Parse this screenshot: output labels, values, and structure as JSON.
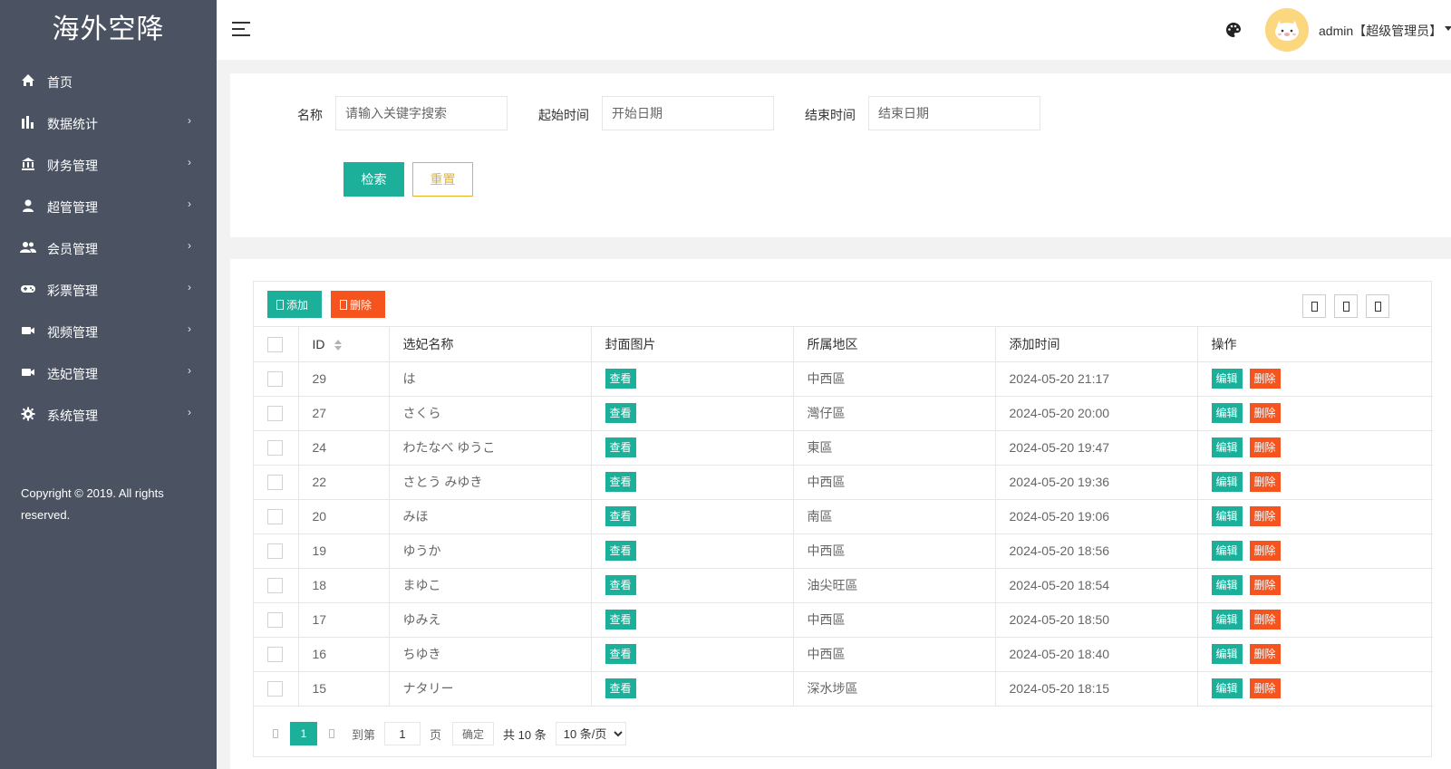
{
  "sidebar": {
    "logo": "海外空降",
    "items": [
      {
        "label": "首页",
        "icon": "home-icon",
        "has_children": false
      },
      {
        "label": "数据统计",
        "icon": "bar-chart-icon",
        "has_children": true
      },
      {
        "label": "财务管理",
        "icon": "bank-icon",
        "has_children": true
      },
      {
        "label": "超管管理",
        "icon": "user-icon",
        "has_children": true
      },
      {
        "label": "会员管理",
        "icon": "users-icon",
        "has_children": true
      },
      {
        "label": "彩票管理",
        "icon": "gamepad-icon",
        "has_children": true
      },
      {
        "label": "视频管理",
        "icon": "video-camera-icon",
        "has_children": true
      },
      {
        "label": "选妃管理",
        "icon": "video-camera-icon",
        "has_children": true
      },
      {
        "label": "系统管理",
        "icon": "gear-icon",
        "has_children": true
      }
    ],
    "chevron": "›",
    "copyright": "Copyright © 2019. All rights reserved."
  },
  "header": {
    "user_name": "admin【超级管理员】"
  },
  "search": {
    "name_label": "名称",
    "name_placeholder": "请输入关键字搜索",
    "start_label": "起始时间",
    "start_placeholder": "开始日期",
    "end_label": "结束时间",
    "end_placeholder": "结束日期",
    "search_button": "检索",
    "reset_button": "重置"
  },
  "toolbar": {
    "add_button": "添加",
    "delete_button": "删除"
  },
  "table": {
    "columns": [
      "ID",
      "选妃名称",
      "封面图片",
      "所属地区",
      "添加时间",
      "操作"
    ],
    "view_label": "查看",
    "edit_label": "编辑",
    "delete_label": "删除",
    "rows": [
      {
        "id": "29",
        "name": "は",
        "region": "中西區",
        "time": "2024-05-20 21:17"
      },
      {
        "id": "27",
        "name": "さくら",
        "region": "灣仔區",
        "time": "2024-05-20 20:00"
      },
      {
        "id": "24",
        "name": "わたなべ ゆうこ",
        "region": "東區",
        "time": "2024-05-20 19:47"
      },
      {
        "id": "22",
        "name": "さとう みゆき",
        "region": "中西區",
        "time": "2024-05-20 19:36"
      },
      {
        "id": "20",
        "name": "みほ",
        "region": "南區",
        "time": "2024-05-20 19:06"
      },
      {
        "id": "19",
        "name": "ゆうか",
        "region": "中西區",
        "time": "2024-05-20 18:56"
      },
      {
        "id": "18",
        "name": "まゆこ",
        "region": "油尖旺區",
        "time": "2024-05-20 18:54"
      },
      {
        "id": "17",
        "name": "ゆみえ",
        "region": "中西區",
        "time": "2024-05-20 18:50"
      },
      {
        "id": "16",
        "name": "ちゆき",
        "region": "中西區",
        "time": "2024-05-20 18:40"
      },
      {
        "id": "15",
        "name": "ナタリー",
        "region": "深水埗區",
        "time": "2024-05-20 18:15"
      }
    ]
  },
  "pager": {
    "current": "1",
    "goto_label": "到第",
    "goto_value": "1",
    "page_label": "页",
    "confirm_label": "确定",
    "total": "共 10 条",
    "page_size": "10 条/页"
  },
  "colors": {
    "sidebar_bg": "#4b5363",
    "primary": "#1cb09a",
    "danger": "#f5541f",
    "warning": "#e8b220"
  }
}
